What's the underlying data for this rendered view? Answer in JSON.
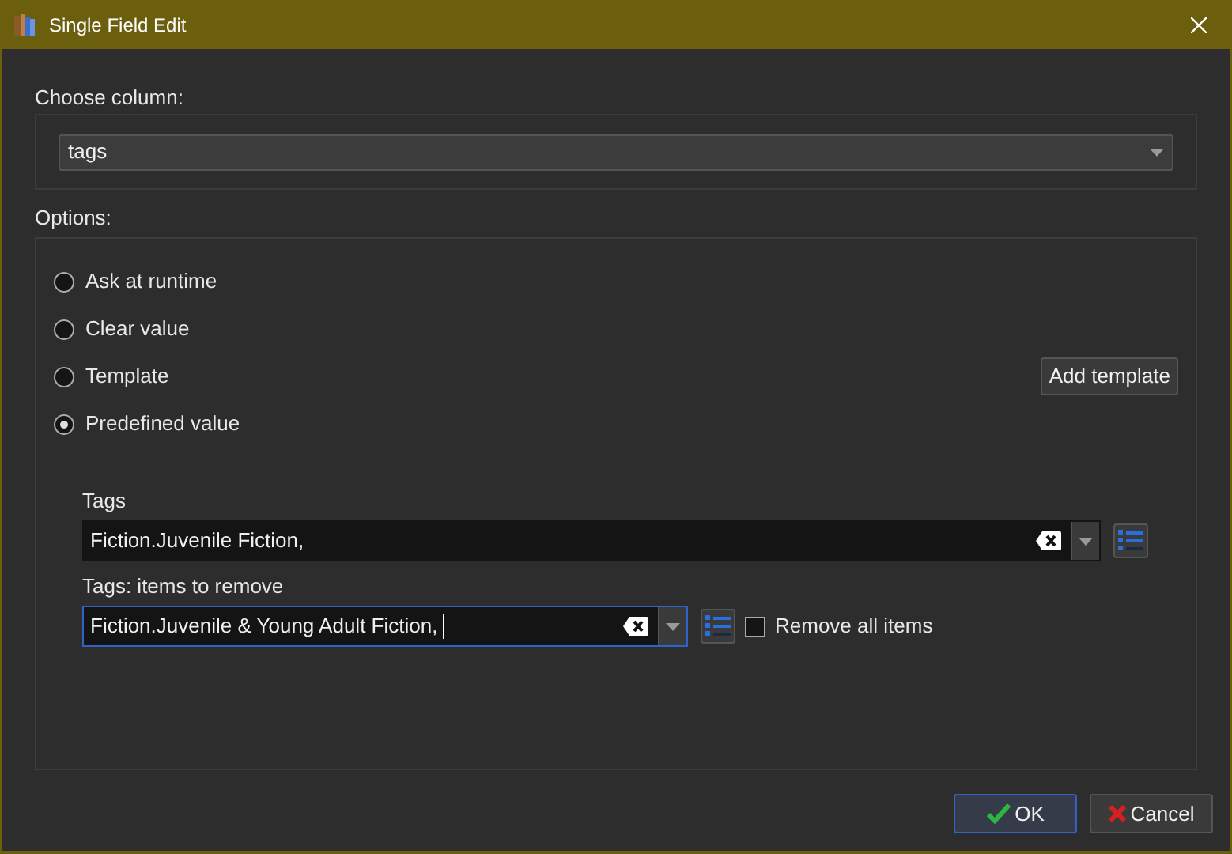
{
  "window": {
    "title": "Single Field Edit"
  },
  "choose_column": {
    "label": "Choose column:",
    "value": "tags"
  },
  "options": {
    "label": "Options:",
    "radios": [
      {
        "label": "Ask at runtime",
        "selected": false
      },
      {
        "label": "Clear value",
        "selected": false
      },
      {
        "label": "Template",
        "selected": false
      },
      {
        "label": "Predefined value",
        "selected": true
      }
    ],
    "add_template_button": "Add template"
  },
  "tags": {
    "label": "Tags",
    "value": "Fiction.Juvenile Fiction,",
    "focused": false
  },
  "items_to_remove": {
    "label": "Tags: items to remove",
    "value": "Fiction.Juvenile & Young Adult Fiction,",
    "focused": true,
    "remove_all": {
      "label": "Remove all items",
      "checked": false
    }
  },
  "buttons": [
    {
      "kind": "ok",
      "label": "OK",
      "default": true
    },
    {
      "kind": "cancel",
      "label": "Cancel",
      "default": false
    }
  ]
}
